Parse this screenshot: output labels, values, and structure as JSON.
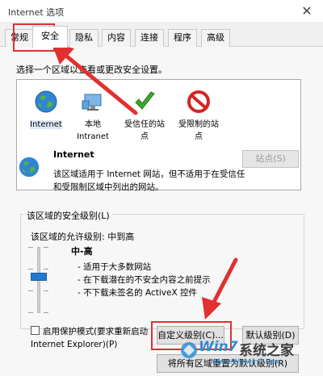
{
  "window": {
    "title": "Internet 选项",
    "close": "✕"
  },
  "tabs": [
    {
      "label": "常规"
    },
    {
      "label": "安全"
    },
    {
      "label": "隐私"
    },
    {
      "label": "内容"
    },
    {
      "label": "连接"
    },
    {
      "label": "程序"
    },
    {
      "label": "高级"
    }
  ],
  "active_tab": "安全",
  "zone_heading": "选择一个区域以查看或更改安全设置。",
  "zones": [
    {
      "line1": "Internet",
      "line2": "",
      "icon": "globe-icon"
    },
    {
      "line1": "本地",
      "line2": "Intranet",
      "icon": "computer-icon"
    },
    {
      "line1": "受信任的站",
      "line2": "点",
      "icon": "checkmark-icon"
    },
    {
      "line1": "受限制的站",
      "line2": "点",
      "icon": "prohibited-icon"
    }
  ],
  "selected_zone": {
    "title": "Internet",
    "description": "该区域适用于 Internet 网站，但不适用于在受信任和受限制区域中列出的网站。",
    "sites_button": "站点(S)"
  },
  "security_level": {
    "legend": "该区域的安全级别(L)",
    "allowed": "该区域的允许级别: 中到高",
    "name": "中-高",
    "bullets": [
      "- 适用于大多数网站",
      "- 在下载潜在的不安全内容之前提示",
      "- 不下载未签名的 ActiveX 控件"
    ],
    "level_fraction": 0.6
  },
  "protected_mode": {
    "line1": "启用保护模式(要求重新启动",
    "line2": "Internet Explorer)(P)",
    "checked": false
  },
  "buttons": {
    "custom": "自定义级别(C)...",
    "default": "默认级别(D)",
    "reset": "将所有区域重置为默认级别(R)"
  },
  "watermark": {
    "brand": "Win7",
    "suffix": "系统之家",
    "url": "Www.Winwin7.com"
  },
  "colors": {
    "highlight_red": "#e03030",
    "slider_blue": "#1d7ad0"
  }
}
